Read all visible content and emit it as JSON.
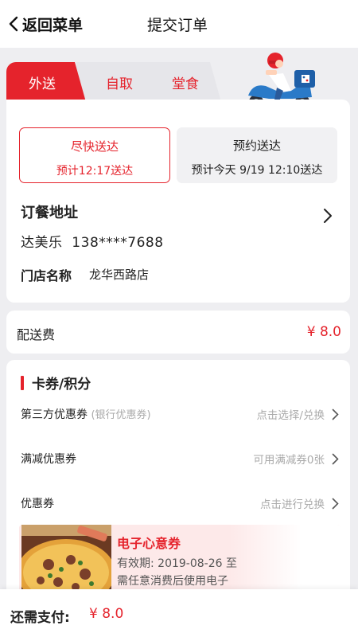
{
  "header": {
    "back_label": "返回菜单",
    "title": "提交订单"
  },
  "tabs": [
    {
      "label": "外送",
      "active": true
    },
    {
      "label": "自取",
      "active": false
    },
    {
      "label": "堂食",
      "active": false
    }
  ],
  "delivery_options": {
    "fast": {
      "title": "尽快送达",
      "eta": "预计12:17送达",
      "selected": true
    },
    "scheduled": {
      "title": "预约送达",
      "eta": "预计今天 9/19 12:10送达",
      "selected": false
    }
  },
  "address": {
    "title": "订餐地址",
    "contact": "达美乐  138****7688",
    "store_label": "门店名称",
    "store_name": "龙华西路店"
  },
  "fee": {
    "label": "配送费",
    "value": "¥ 8.0"
  },
  "coupons": {
    "section_title": "卡券/积分",
    "rows": [
      {
        "label": "第三方优惠券",
        "sub": "(银行优惠券)",
        "hint": "点击选择/兑换"
      },
      {
        "label": "满减优惠券",
        "sub": "",
        "hint": "可用满减券0张"
      },
      {
        "label": "优惠券",
        "sub": "",
        "hint": "点击进行兑换"
      }
    ],
    "ecard": {
      "title": "电子心意券",
      "validity": "有效期: 2019-08-26 至",
      "desc": "需任意消费后使用电子"
    }
  },
  "payment": {
    "label": "还需支付:",
    "amount": "¥ 8.0"
  },
  "colors": {
    "accent": "#e5232c",
    "background": "#eeeef1"
  },
  "icons": [
    "chevron-left-icon",
    "chevron-right-icon",
    "delivery-rider-illustration",
    "pizza-image"
  ]
}
